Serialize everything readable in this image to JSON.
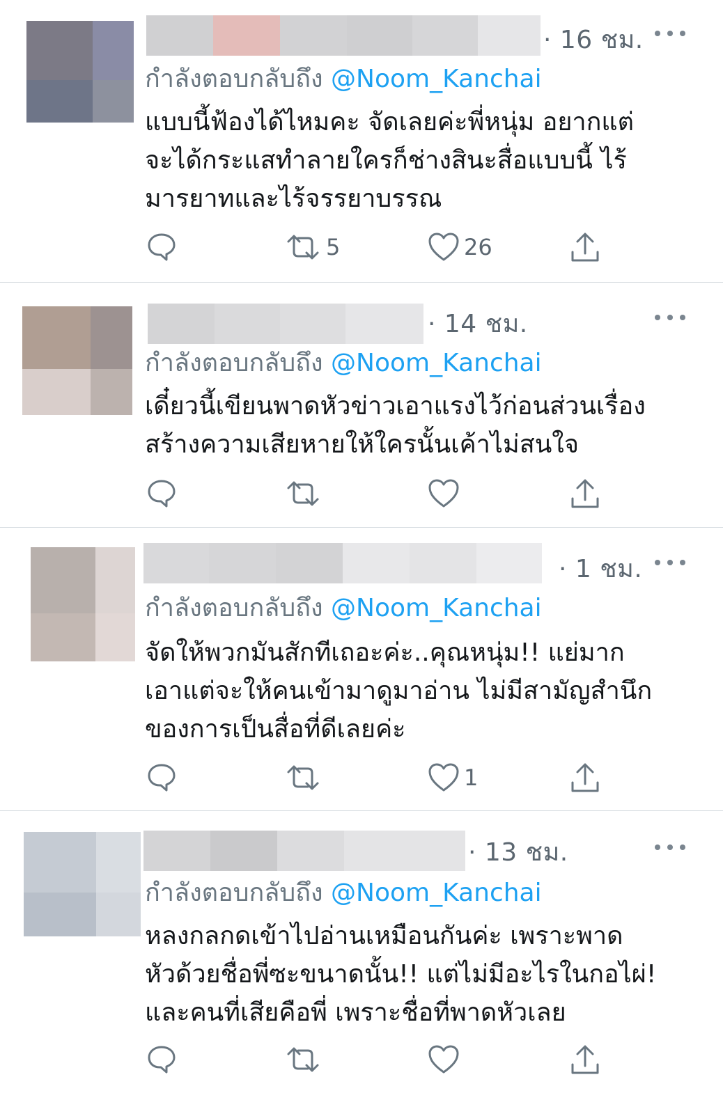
{
  "tweets": [
    {
      "time": "· 16 ชม.",
      "reply_prefix": "กำลังตอบกลับถึง",
      "reply_handle": "@Noom_Kanchai",
      "lines": [
        "แบบนี้ฟ้องได้ไหมคะ จัดเลยค่ะพี่หนุ่ม อยากแต่",
        "จะได้กระแสทำลายใครก็ช่างสินะสื่อแบบนี้ ไร้",
        "มารยาทและไร้จรรยาบรรณ"
      ],
      "retweets": "5",
      "likes": "26"
    },
    {
      "time": "· 14 ชม.",
      "reply_prefix": "กำลังตอบกลับถึง",
      "reply_handle": "@Noom_Kanchai",
      "lines": [
        "เดี๋ยวนี้เขียนพาดหัวข่าวเอาแรงไว้ก่อนส่วนเรื่อง",
        "สร้างความเสียหายให้ใครนั้นเค้าไม่สนใจ"
      ],
      "retweets": "",
      "likes": ""
    },
    {
      "time": "· 1 ชม.",
      "reply_prefix": "กำลังตอบกลับถึง",
      "reply_handle": "@Noom_Kanchai",
      "lines": [
        "จัดให้พวกมันสักทีเถอะค่ะ..คุณหนุ่ม!! แย่มาก",
        "เอาแต่จะให้คนเข้ามาดูมาอ่าน ไม่มีสามัญสำนึก",
        "ของการเป็นสื่อที่ดีเลยค่ะ"
      ],
      "retweets": "",
      "likes": "1"
    },
    {
      "time": "· 13 ชม.",
      "reply_prefix": "กำลังตอบกลับถึง",
      "reply_handle": "@Noom_Kanchai",
      "lines": [
        "หลงกลกดเข้าไปอ่านเหมือนกันค่ะ เพราะพาด",
        "หัวด้วยชื่อพี่ซะขนาดนั้น!! แต่ไม่มีอะไรในกอไผ่!",
        "และคนที่เสียคือพี่ เพราะชื่อที่พาดหัวเลย"
      ],
      "retweets": "",
      "likes": ""
    }
  ],
  "colors": {
    "link": "#1da1f2",
    "text": "#14171a",
    "muted": "#697680",
    "divider": "#d6dbe0",
    "icon": "#697680"
  }
}
